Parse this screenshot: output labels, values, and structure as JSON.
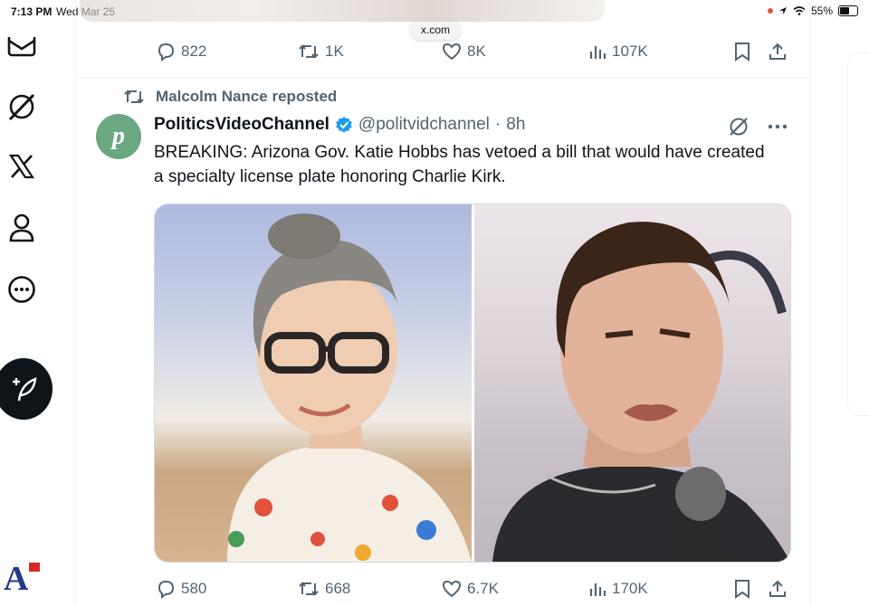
{
  "status_bar": {
    "time": "7:13 PM",
    "date": "Wed Mar 25",
    "battery": "55%"
  },
  "browser": {
    "url": "x.com"
  },
  "prev_post_actions": {
    "replies": "822",
    "reposts": "1K",
    "likes": "8K",
    "views": "107K"
  },
  "repost_banner": {
    "text": "Malcolm Nance reposted"
  },
  "post": {
    "avatar_letter": "p",
    "display_name": "PoliticsVideoChannel",
    "handle": "@politvidchannel",
    "separator": "·",
    "time": "8h",
    "text": "BREAKING:  Arizona Gov. Katie Hobbs has vetoed a bill that would have created a specialty license plate honoring Charlie Kirk.",
    "actions": {
      "replies": "580",
      "reposts": "668",
      "likes": "6.7K",
      "views": "170K"
    }
  },
  "nav_icons": [
    "mail-icon",
    "grok-icon",
    "x-logo-icon",
    "profile-icon",
    "more-icon",
    "compose-icon"
  ],
  "logo_letter": "A",
  "colors": {
    "accent": "#1d9bf0",
    "text": "#0f1419",
    "muted": "#536471",
    "avatar": "#6aa880"
  }
}
